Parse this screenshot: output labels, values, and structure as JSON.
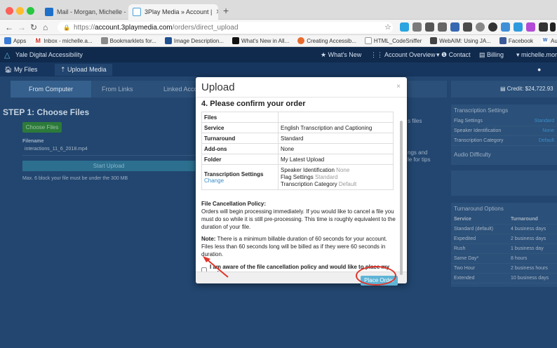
{
  "browser": {
    "tabs": [
      {
        "title": "Mail - Morgan, Michelle - Outl",
        "icon": "outlook-icon",
        "active": false
      },
      {
        "title": "3Play Media » Account |",
        "icon": "3play-icon",
        "active": true
      }
    ],
    "url_protocol": "https://",
    "url_host": "account.3playmedia.com",
    "url_path": "/orders/direct_upload",
    "bookmarks": [
      "Apps",
      "Inbox - michelle.a...",
      "Bookmarklets for...",
      "Image Description...",
      "What's New in All...",
      "Creating Accessib...",
      "HTML_CodeSniffer",
      "WebAIM: Using JA...",
      "Facebook",
      "Authoring Tool Ac..."
    ]
  },
  "site": {
    "org": "Yale Digital Accessibility",
    "nav": [
      "What's New",
      "Account Overview",
      "Contact",
      "Billing",
      "michelle.morga"
    ],
    "subnav": [
      "My Files",
      "Upload Media"
    ],
    "upload_tabs": [
      "From Computer",
      "From Links",
      "Linked Acco"
    ],
    "credit": "Credit: $24,722.93",
    "step_title": "STEP 1: Choose Files",
    "choose_files": "Choose Files",
    "filename_label": "Filename",
    "filename": "interactions_11_6_2018.mp4",
    "start_upload": "Start Upload",
    "size_note": "Max. 6 block your file must be under the 300 MB",
    "right_panels": {
      "transcription_settings": "Transcription Settings",
      "settings_rows": [
        [
          "Flag Settings",
          "Standard"
        ],
        [
          "Speaker Identification",
          "None"
        ],
        [
          "Transcription Category",
          "Default"
        ]
      ],
      "audio_difficulty": "Audio Difficulty",
      "turnaround_options": "Turnaround Options",
      "turn_header": [
        "Service",
        "Turnaround"
      ],
      "turn_rows": [
        [
          "Standard (default)",
          "4 business days"
        ],
        [
          "Expedited",
          "2 business days"
        ],
        [
          "Rush",
          "1 business day"
        ],
        [
          "Same Day*",
          "8 hours"
        ],
        [
          "Two Hour",
          "2 business hours"
        ],
        [
          "Extended",
          "10 business days"
        ]
      ]
    },
    "side_text": [
      "s files",
      "ngs and",
      "le for tips"
    ]
  },
  "modal": {
    "title": "Upload",
    "close": "×",
    "heading": "4. Please confirm your order",
    "rows": [
      {
        "k": "Files",
        "v": ""
      },
      {
        "k": "Service",
        "v": "English Transcription and Captioning"
      },
      {
        "k": "Turnaround",
        "v": "Standard"
      },
      {
        "k": "Add-ons",
        "v": "None"
      },
      {
        "k": "Folder",
        "v": "My Latest Upload"
      }
    ],
    "ts_label": "Transcription Settings",
    "ts_change": "Change",
    "ts_values": [
      {
        "label": "Speaker Identification",
        "value": "None"
      },
      {
        "label": "Flag Settings",
        "value": "Standard"
      },
      {
        "label": "Transcription Category",
        "value": "Default"
      }
    ],
    "policy_title": "File Cancellation Policy:",
    "policy_text": "Orders will begin processing immediately. If you would like to cancel a file you must do so while it is still pre-processing. This time is roughly equivalent to the duration of your file.",
    "note_label": "Note:",
    "note_text": " There is a minimum billable duration of 60 seconds for your account. Files less than 60 seconds long will be billed as if they were 60 seconds in duration.",
    "ack_label": "I am aware of the file cancellation policy and would like to place my order",
    "ack_checked": false,
    "place_order": "Place Order"
  },
  "colors": {
    "annotation": "#e0352b",
    "accent": "#5eb4d6"
  }
}
